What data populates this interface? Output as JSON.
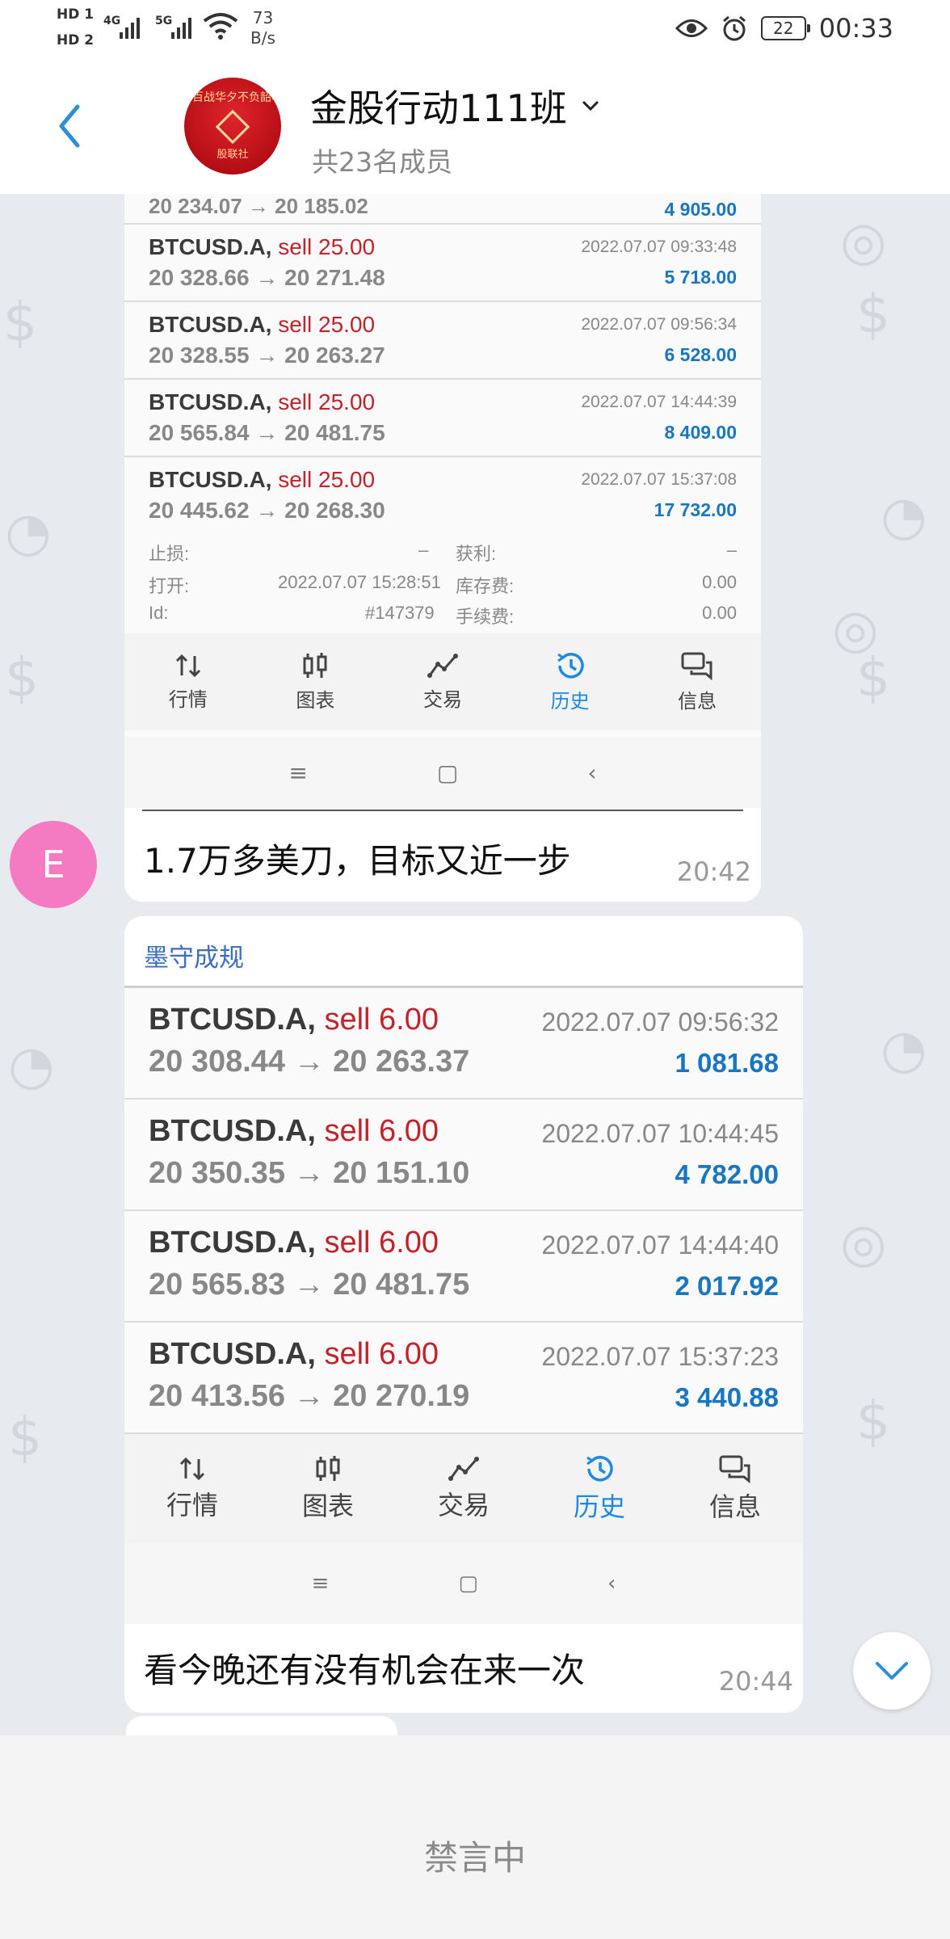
{
  "status_bar": {
    "hd1": "HD 1",
    "hd2": "HD 2",
    "sig1": "4G",
    "sig2": "5G",
    "speed_value": "73",
    "speed_unit": "B/s",
    "battery": "22",
    "time": "00:33"
  },
  "header": {
    "group_name": "金股行动111班",
    "member_count": "共23名成员",
    "avatar_banner": "百战华夕不负韶华",
    "avatar_brand": "股联社"
  },
  "messages": [
    {
      "sender_initial": "E",
      "trades_top_partial": {
        "prices": "20 234.07 → 20 185.02",
        "profit": "4 905.00"
      },
      "trades": [
        {
          "symbol": "BTCUSD.A,",
          "action": "sell 25.00",
          "prices": "20 328.66 → 20 271.48",
          "time": "2022.07.07 09:33:48",
          "profit": "5 718.00"
        },
        {
          "symbol": "BTCUSD.A,",
          "action": "sell 25.00",
          "prices": "20 328.55 → 20 263.27",
          "time": "2022.07.07 09:56:34",
          "profit": "6 528.00"
        },
        {
          "symbol": "BTCUSD.A,",
          "action": "sell 25.00",
          "prices": "20 565.84 → 20 481.75",
          "time": "2022.07.07 14:44:39",
          "profit": "8 409.00"
        },
        {
          "symbol": "BTCUSD.A,",
          "action": "sell 25.00",
          "prices": "20 445.62 → 20 268.30",
          "time": "2022.07.07 15:37:08",
          "profit": "17 732.00"
        }
      ],
      "details": {
        "stop_loss_label": "止损:",
        "stop_loss_value": "–",
        "take_profit_label": "获利:",
        "take_profit_value": "–",
        "open_label": "打开:",
        "open_value": "2022.07.07 15:28:51",
        "swap_label": "库存费:",
        "swap_value": "0.00",
        "id_label": "Id:",
        "id_value": "#147379",
        "fee_label": "手续费:",
        "fee_value": "0.00"
      },
      "text": "1.7万多美刀，目标又近一步",
      "time": "20:42"
    },
    {
      "sender_name": "墨守成规",
      "trades": [
        {
          "symbol": "BTCUSD.A,",
          "action": "sell 6.00",
          "prices": "20 308.44 → 20 263.37",
          "time": "2022.07.07 09:56:32",
          "profit": "1 081.68"
        },
        {
          "symbol": "BTCUSD.A,",
          "action": "sell 6.00",
          "prices": "20 350.35 → 20 151.10",
          "time": "2022.07.07 10:44:45",
          "profit": "4 782.00"
        },
        {
          "symbol": "BTCUSD.A,",
          "action": "sell 6.00",
          "prices": "20 565.83 → 20 481.75",
          "time": "2022.07.07 14:44:40",
          "profit": "2 017.92"
        },
        {
          "symbol": "BTCUSD.A,",
          "action": "sell 6.00",
          "prices": "20 413.56 → 20 270.19",
          "time": "2022.07.07 15:37:23",
          "profit": "3 440.88"
        }
      ],
      "text": "看今晚还有没有机会在来一次",
      "time": "20:44"
    }
  ],
  "app_tabs": [
    "行情",
    "图表",
    "交易",
    "历史",
    "信息"
  ],
  "active_tab": "历史",
  "footer": {
    "muted_label": "禁言中"
  },
  "colors": {
    "sell": "#c2222a",
    "profit": "#1976c2",
    "active_tab": "#1e88e5",
    "avatar_e": "#f47bc1",
    "sender_name": "#3b6fbf"
  }
}
